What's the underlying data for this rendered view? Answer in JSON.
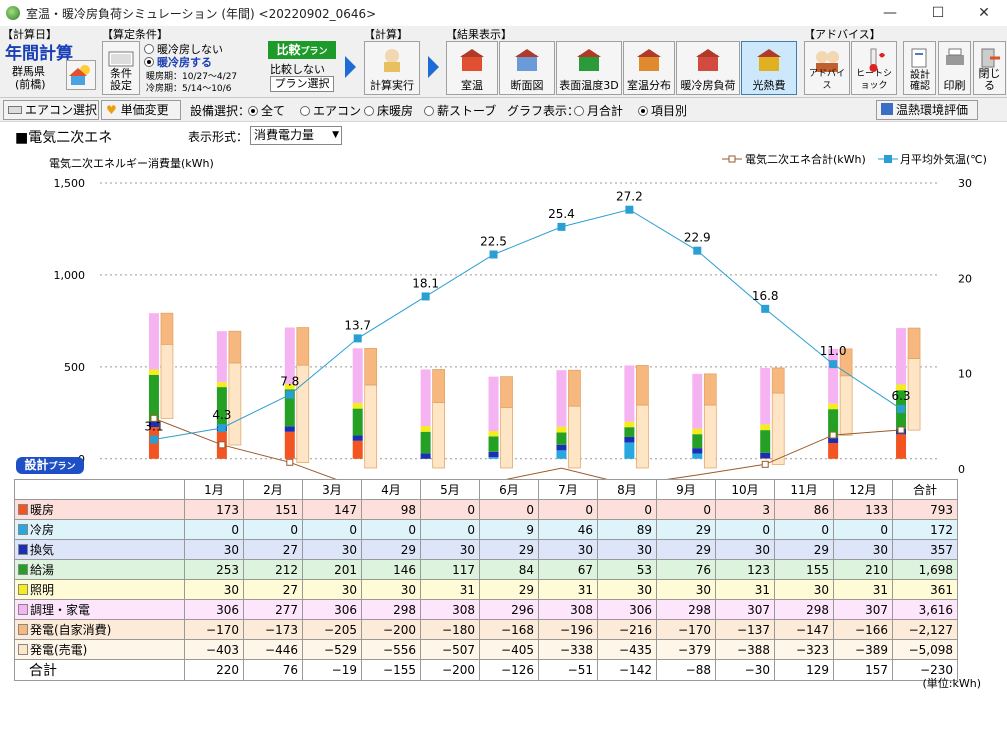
{
  "window": {
    "title": "室温・暖冷房負荷シミュレーション (年間) <20220902_0646>",
    "minimize": "—",
    "maximize": "☐",
    "close": "✕"
  },
  "toolbar": {
    "calc_day": {
      "group_label": "【計算日】",
      "value": "年間計算",
      "region_line1": "群馬県",
      "region_line2": "(前橋)"
    },
    "conditions": {
      "group_label": "【算定条件】",
      "button_label_1": "条件",
      "button_label_2": "設定",
      "radio_off": "暖冷房しない",
      "radio_on": "暖冷房する",
      "heating_period": "暖房期：10/27～4/27",
      "cooling_period": "冷房期：5/14～10/6",
      "compare_badge": "比較",
      "compare_badge_sub": "プラン",
      "compare_off": "比較しない",
      "plan_select": "プラン選択"
    },
    "calc": {
      "group_label": "【計算】",
      "run_label": "計算実行"
    },
    "results": {
      "group_label": "【結果表示】",
      "buttons": [
        "室温",
        "断面図",
        "表面温度3D",
        "室温分布",
        "暖冷房負荷",
        "光熱費"
      ]
    },
    "advice": {
      "group_label": "【アドバイス】",
      "buttons": [
        "アドバイス",
        "ヒートショック"
      ]
    },
    "misc": {
      "buttons": [
        "設計確認",
        "印刷",
        "閉じる"
      ]
    }
  },
  "optbar": {
    "ac_select": "エアコン選択",
    "unit_price": "単価変更",
    "equip_label": "設備選択：",
    "equip_options": [
      "全て",
      "エアコン",
      "床暖房",
      "薪ストーブ"
    ],
    "graph_label": "グラフ表示：",
    "graph_options": [
      "月合計",
      "項目別"
    ],
    "eval_button": "温熱環境評価"
  },
  "chart_header": {
    "section_title": "■電気二次エネ",
    "format_label": "表示形式：",
    "format_value": "消費電力量",
    "design_badge": "設計",
    "design_badge_sub": "プラン",
    "unit_note": "(単位:kWh)"
  },
  "colors": {
    "heating": "#f25522",
    "cooling": "#29a8e0",
    "ventilation": "#1a2fb4",
    "hotwater": "#25a025",
    "lighting": "#f4ec1c",
    "cooking": "#f6b3f2",
    "gen_self": "#f6b87e",
    "gen_sell": "#fde5c6",
    "total_line": "#9a5a2a",
    "temp_line": "#2a9fd3"
  },
  "chart_data": {
    "type": "bar",
    "ylabel": "電気二次エネルギー消費量(kWh)",
    "ylim": [
      -50,
      1500
    ],
    "y_ticks": [
      "1,500",
      "1,000",
      "500",
      "0"
    ],
    "y2lim": [
      0,
      30
    ],
    "y2_ticks": [
      "30",
      "20",
      "10",
      "0"
    ],
    "categories": [
      "1月",
      "2月",
      "3月",
      "4月",
      "5月",
      "6月",
      "7月",
      "8月",
      "9月",
      "10月",
      "11月",
      "12月"
    ],
    "stack_series": [
      {
        "key": "heating",
        "name": "暖房",
        "values": [
          173,
          151,
          147,
          98,
          0,
          0,
          0,
          0,
          0,
          3,
          86,
          133
        ]
      },
      {
        "key": "cooling",
        "name": "冷房",
        "values": [
          0,
          0,
          0,
          0,
          0,
          9,
          46,
          89,
          29,
          0,
          0,
          0
        ]
      },
      {
        "key": "ventilation",
        "name": "換気",
        "values": [
          30,
          27,
          30,
          29,
          30,
          29,
          30,
          30,
          29,
          30,
          29,
          30
        ]
      },
      {
        "key": "hotwater",
        "name": "給湯",
        "values": [
          253,
          212,
          201,
          146,
          117,
          84,
          67,
          53,
          76,
          123,
          155,
          210
        ]
      },
      {
        "key": "lighting",
        "name": "照明",
        "values": [
          30,
          27,
          30,
          30,
          31,
          29,
          31,
          30,
          30,
          31,
          30,
          31
        ]
      },
      {
        "key": "cooking",
        "name": "調理・家電",
        "values": [
          306,
          277,
          306,
          298,
          308,
          296,
          308,
          306,
          298,
          307,
          298,
          307
        ]
      }
    ],
    "gen_series": [
      {
        "key": "gen_self",
        "name": "発電(自家消費)",
        "values": [
          -170,
          -173,
          -205,
          -200,
          -180,
          -168,
          -196,
          -216,
          -170,
          -137,
          -147,
          -166
        ]
      },
      {
        "key": "gen_sell",
        "name": "発電(売電)",
        "values": [
          -403,
          -446,
          -529,
          -556,
          -507,
          -405,
          -338,
          -435,
          -379,
          -388,
          -323,
          -389
        ]
      }
    ],
    "totals": {
      "name": "合計",
      "values": [
        220,
        76,
        -19,
        -155,
        -200,
        -126,
        -51,
        -142,
        -88,
        -30,
        129,
        157
      ]
    },
    "total_col_label": "合計",
    "row_totals": [
      "793",
      "172",
      "357",
      "1,698",
      "361",
      "3,616",
      "-2,127",
      "-5,098",
      "-230"
    ],
    "temperature": {
      "name": "月平均外気温(℃)",
      "values": [
        3.1,
        4.3,
        7.8,
        13.7,
        18.1,
        22.5,
        25.4,
        27.2,
        22.9,
        16.8,
        11.0,
        6.3
      ],
      "labels": [
        "3.1",
        "4.3",
        "7.8",
        "13.7",
        "18.1",
        "22.5",
        "25.4",
        "27.2",
        "22.9",
        "16.8",
        "11.0",
        "6.3"
      ]
    },
    "legend": [
      "電気二次エネ合計(kWh)",
      "月平均外気温(℃)"
    ],
    "legend_position": "top-right",
    "grid": true
  }
}
